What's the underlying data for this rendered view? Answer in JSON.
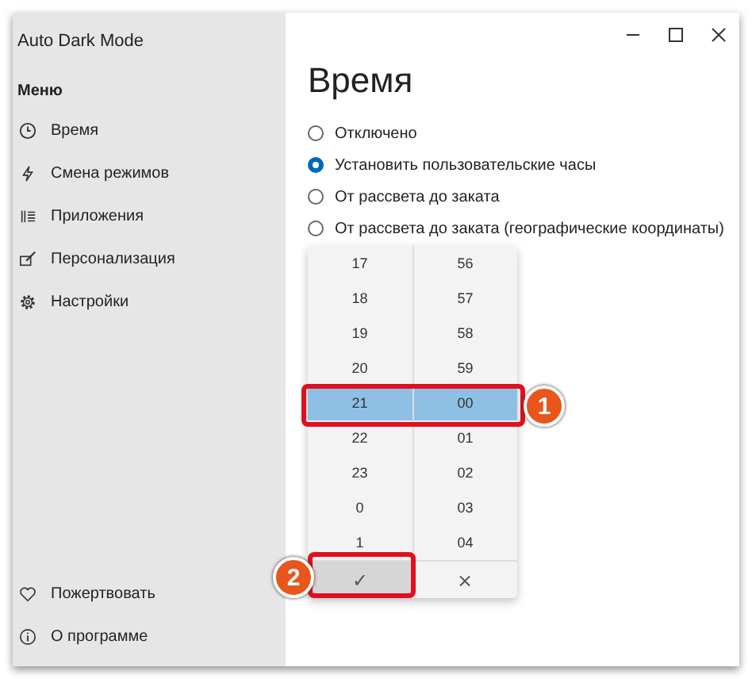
{
  "window": {
    "title": "Auto Dark Mode"
  },
  "sidebar": {
    "header": "Меню",
    "items": [
      {
        "label": "Время",
        "kind": "clock"
      },
      {
        "label": "Смена режимов",
        "kind": "bolt"
      },
      {
        "label": "Приложения",
        "kind": "list"
      },
      {
        "label": "Персонализация",
        "kind": "brush"
      },
      {
        "label": "Настройки",
        "kind": "gear"
      }
    ],
    "bottom_items": [
      {
        "label": "Пожертвовать",
        "kind": "heart"
      },
      {
        "label": "О программе",
        "kind": "info"
      }
    ]
  },
  "page": {
    "title": "Время",
    "options": [
      {
        "label": "Отключено",
        "selected": false
      },
      {
        "label": "Установить пользовательские часы",
        "selected": true
      },
      {
        "label": "От рассвета до заката",
        "selected": false
      },
      {
        "label": "От рассвета до заката (географические координаты)",
        "selected": false
      }
    ]
  },
  "time_picker": {
    "hours": [
      {
        "label": "17",
        "selected": false
      },
      {
        "label": "18",
        "selected": false
      },
      {
        "label": "19",
        "selected": false
      },
      {
        "label": "20",
        "selected": false
      },
      {
        "label": "21",
        "selected": true
      },
      {
        "label": "22",
        "selected": false
      },
      {
        "label": "23",
        "selected": false
      },
      {
        "label": "0",
        "selected": false
      },
      {
        "label": "1",
        "selected": false
      }
    ],
    "minutes": [
      {
        "label": "56",
        "selected": false
      },
      {
        "label": "57",
        "selected": false
      },
      {
        "label": "58",
        "selected": false
      },
      {
        "label": "59",
        "selected": false
      },
      {
        "label": "00",
        "selected": true
      },
      {
        "label": "01",
        "selected": false
      },
      {
        "label": "02",
        "selected": false
      },
      {
        "label": "03",
        "selected": false
      },
      {
        "label": "04",
        "selected": false
      }
    ],
    "accept": "✓",
    "cancel": "×"
  },
  "callouts": [
    {
      "number": "1"
    },
    {
      "number": "2"
    }
  ]
}
